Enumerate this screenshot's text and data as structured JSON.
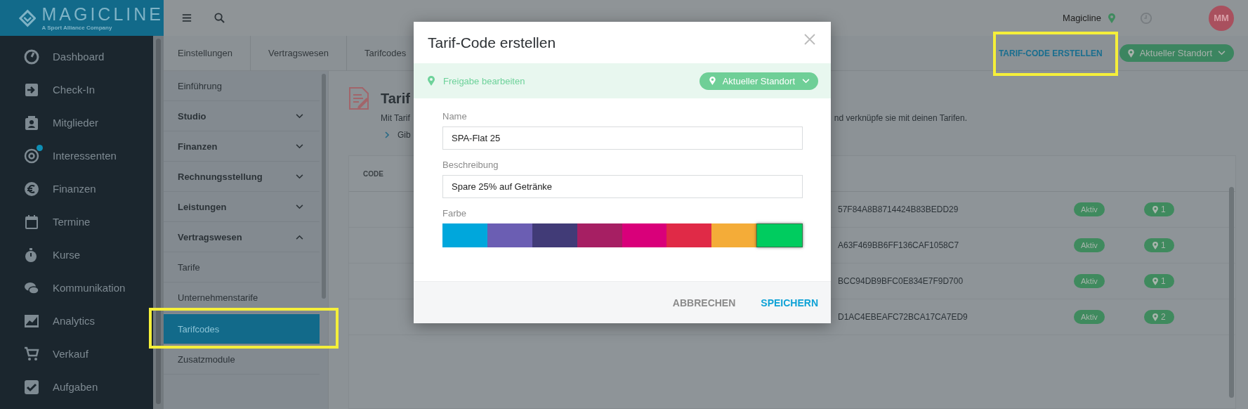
{
  "brand": {
    "name": "MAGICLINE",
    "tagline": "A Sport Alliance Company"
  },
  "topbar": {
    "location": "Magicline",
    "avatar": "MM"
  },
  "sidebar": {
    "items": [
      {
        "label": "Dashboard",
        "notification": false
      },
      {
        "label": "Check-In",
        "notification": false
      },
      {
        "label": "Mitglieder",
        "notification": false
      },
      {
        "label": "Interessenten",
        "notification": true
      },
      {
        "label": "Finanzen",
        "notification": false
      },
      {
        "label": "Termine",
        "notification": false
      },
      {
        "label": "Kurse",
        "notification": false
      },
      {
        "label": "Kommunikation",
        "notification": false
      },
      {
        "label": "Analytics",
        "notification": false
      },
      {
        "label": "Verkauf",
        "notification": false
      },
      {
        "label": "Aufgaben",
        "notification": false
      }
    ]
  },
  "breadcrumb": [
    "Einstellungen",
    "Vertragswesen",
    "Tarifcodes"
  ],
  "actions": {
    "create": "TARIF-CODE ERSTELLEN",
    "location": "Aktueller Standort"
  },
  "settings_nav": {
    "items": [
      {
        "label": "Einführung",
        "kind": "link",
        "selected": false
      },
      {
        "label": "Studio",
        "kind": "group",
        "expanded": false
      },
      {
        "label": "Finanzen",
        "kind": "group",
        "expanded": false
      },
      {
        "label": "Rechnungsstellung",
        "kind": "group",
        "expanded": false
      },
      {
        "label": "Leistungen",
        "kind": "group",
        "expanded": false
      },
      {
        "label": "Vertragswesen",
        "kind": "group",
        "expanded": true
      },
      {
        "label": "Tarife",
        "kind": "link",
        "selected": false
      },
      {
        "label": "Unternehmenstarife",
        "kind": "link",
        "selected": false
      },
      {
        "label": "Tarifcodes",
        "kind": "link",
        "selected": true
      },
      {
        "label": "Zusatzmodule",
        "kind": "link",
        "selected": false
      }
    ]
  },
  "page": {
    "title": "Tarif",
    "intro": [
      "Mit Tarif",
      "nd verknüpfe sie mit deinen Tarifen."
    ],
    "hint": "Gib"
  },
  "table": {
    "columns": [
      "CODE"
    ],
    "rows": [
      {
        "code": "57F84A8B8714424B83BEDD29",
        "status": "Aktiv",
        "locations": "1"
      },
      {
        "code": "A63F469BB6FF136CAF1058C7",
        "status": "Aktiv",
        "locations": "1"
      },
      {
        "code": "BCC94DB9BFC0E834E7F9D700",
        "status": "Aktiv",
        "locations": "1"
      },
      {
        "code": "D1AC4EBEAFC72BCA17CA7ED9",
        "status": "Aktiv",
        "locations": "2"
      }
    ]
  },
  "modal": {
    "title": "Tarif-Code erstellen",
    "sharing": {
      "label": "Freigabe bearbeiten",
      "location": "Aktueller Standort"
    },
    "fields": [
      {
        "label": "Name",
        "value": "SPA-Flat 25"
      },
      {
        "label": "Beschreibung",
        "value": "Spare 25% auf Getränke"
      }
    ],
    "color_label": "Farbe",
    "colors": [
      {
        "color": "#00a7dc",
        "selected": false
      },
      {
        "color": "#6b5eb3",
        "selected": false
      },
      {
        "color": "#413b77",
        "selected": false
      },
      {
        "color": "#a61f63",
        "selected": false
      },
      {
        "color": "#d9007a",
        "selected": false
      },
      {
        "color": "#e02a47",
        "selected": false
      },
      {
        "color": "#f4ac38",
        "selected": false
      },
      {
        "color": "#00cc5f",
        "selected": true
      }
    ],
    "buttons": [
      {
        "label": "ABBRECHEN",
        "kind": "secondary"
      },
      {
        "label": "SPEICHERN",
        "kind": "primary"
      }
    ]
  }
}
